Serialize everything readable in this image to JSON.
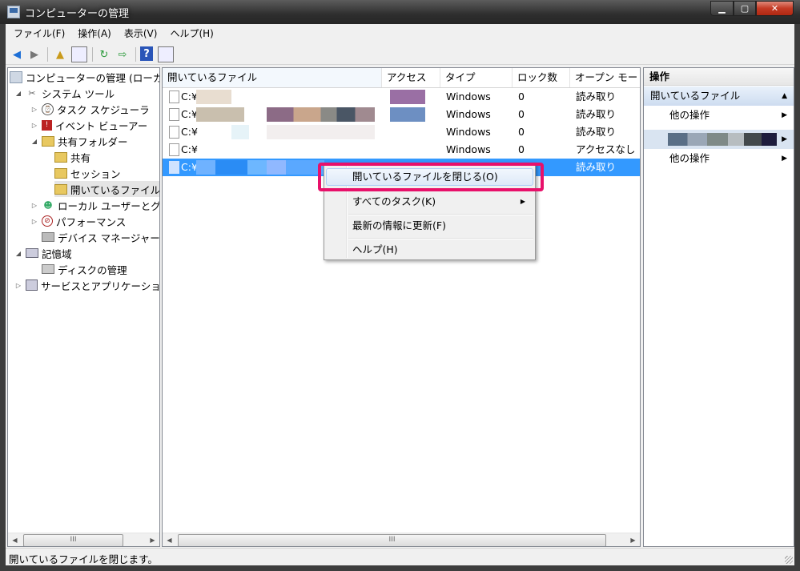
{
  "window": {
    "title": "コンピューターの管理",
    "minimize": "▁",
    "maximize": "▢",
    "close": "✕"
  },
  "menu": [
    "ファイル(F)",
    "操作(A)",
    "表示(V)",
    "ヘルプ(H)"
  ],
  "tree": {
    "items": [
      {
        "label": "コンピューターの管理 (ローカ",
        "expander": "",
        "icon": "computer-management-icon"
      },
      {
        "label": "システム ツール",
        "expander": "◢",
        "icon": "tools-icon"
      },
      {
        "label": "タスク スケジューラ",
        "expander": "▷",
        "icon": "clock-icon"
      },
      {
        "label": "イベント ビューアー",
        "expander": "▷",
        "icon": "event-viewer-icon"
      },
      {
        "label": "共有フォルダー",
        "expander": "◢",
        "icon": "shared-folder-icon"
      },
      {
        "label": "共有",
        "expander": "",
        "icon": "share-icon"
      },
      {
        "label": "セッション",
        "expander": "",
        "icon": "session-icon"
      },
      {
        "label": "開いているファイル",
        "expander": "",
        "icon": "open-files-icon"
      },
      {
        "label": "ローカル ユーザーとグ",
        "expander": "▷",
        "icon": "users-icon"
      },
      {
        "label": "パフォーマンス",
        "expander": "▷",
        "icon": "performance-icon"
      },
      {
        "label": "デバイス マネージャー",
        "expander": "",
        "icon": "device-manager-icon"
      },
      {
        "label": "記憶域",
        "expander": "◢",
        "icon": "storage-icon"
      },
      {
        "label": "ディスクの管理",
        "expander": "",
        "icon": "disk-icon"
      },
      {
        "label": "サービスとアプリケーショ",
        "expander": "▷",
        "icon": "services-icon"
      }
    ]
  },
  "list": {
    "columns": [
      "開いているファイル",
      "アクセス",
      "タイプ",
      "ロック数",
      "オープン モー"
    ],
    "sort_glyph": "^",
    "rows": [
      {
        "file": "C:¥",
        "type": "Windows",
        "locks": "0",
        "mode": "読み取り"
      },
      {
        "file": "C:¥",
        "type": "Windows",
        "locks": "0",
        "mode": "読み取り"
      },
      {
        "file": "C:¥",
        "type": "Windows",
        "locks": "0",
        "mode": "読み取り"
      },
      {
        "file": "C:¥",
        "type": "Windows",
        "locks": "0",
        "mode": "アクセスなし"
      },
      {
        "file": "C:¥",
        "type": "",
        "locks": "",
        "mode": "読み取り"
      }
    ]
  },
  "actions": {
    "header": "操作",
    "section1": "開いているファイル",
    "other_ops": "他の操作",
    "other_ops2": "他の操作"
  },
  "context_menu": {
    "items": [
      "開いているファイルを閉じる(O)",
      "すべてのタスク(K)",
      "最新の情報に更新(F)",
      "ヘルプ(H)"
    ]
  },
  "scroll": {
    "thumb_grip": "III"
  },
  "status": "開いているファイルを閉じます。",
  "colors": {
    "highlight": "#e8106a",
    "selection": "#3399ff"
  }
}
